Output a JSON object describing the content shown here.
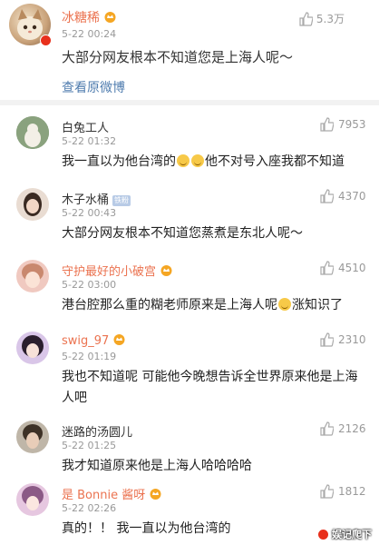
{
  "post": {
    "username": "冰糖稀",
    "time": "5-22 00:24",
    "likes": "5.3万",
    "content": "大部分网友根本不知道您是上海人呢～",
    "view_original": "查看原微博"
  },
  "comments": [
    {
      "username": "白兔工人",
      "time": "5-22 01:32",
      "likes": "7953",
      "text": "我一直以为他台湾的",
      "text_after": "他不对号入座我都不知道",
      "emojis": 2,
      "highlight": false,
      "crown": false
    },
    {
      "username": "木子水桶",
      "badge": "铁粉",
      "time": "5-22 00:43",
      "likes": "4370",
      "text": "大部分网友根本不知道您蒸煮是东北人呢～",
      "highlight": false,
      "crown": false
    },
    {
      "username": "守护最好的小破宫",
      "time": "5-22 03:00",
      "likes": "4510",
      "text": "港台腔那么重的糊老师原来是上海人呢",
      "text_after": "涨知识了",
      "emojis": 1,
      "highlight": true,
      "crown": true
    },
    {
      "username": "swig_97",
      "time": "5-22 01:19",
      "likes": "2310",
      "text": "我也不知道呢 可能他今晚想告诉全世界原来他是上海人吧",
      "highlight": true,
      "crown": true
    },
    {
      "username": "迷路的汤圆儿",
      "time": "5-22 01:25",
      "likes": "2126",
      "text": "我才知道原来他是上海人哈哈哈哈",
      "highlight": false,
      "crown": false
    },
    {
      "username": "是 Bonnie 酱呀",
      "time": "5-22 02:26",
      "likes": "1812",
      "text": "真的！！ 我一直以为他台湾的",
      "highlight": true,
      "crown": true
    }
  ],
  "watermark": "娱记爬下",
  "colors": {
    "highlight_name": "#eb7350",
    "link": "#507daf",
    "muted": "#999999"
  },
  "icons": [
    "vip-crown-icon",
    "thumbs-up-icon",
    "verified-badge-icon"
  ]
}
